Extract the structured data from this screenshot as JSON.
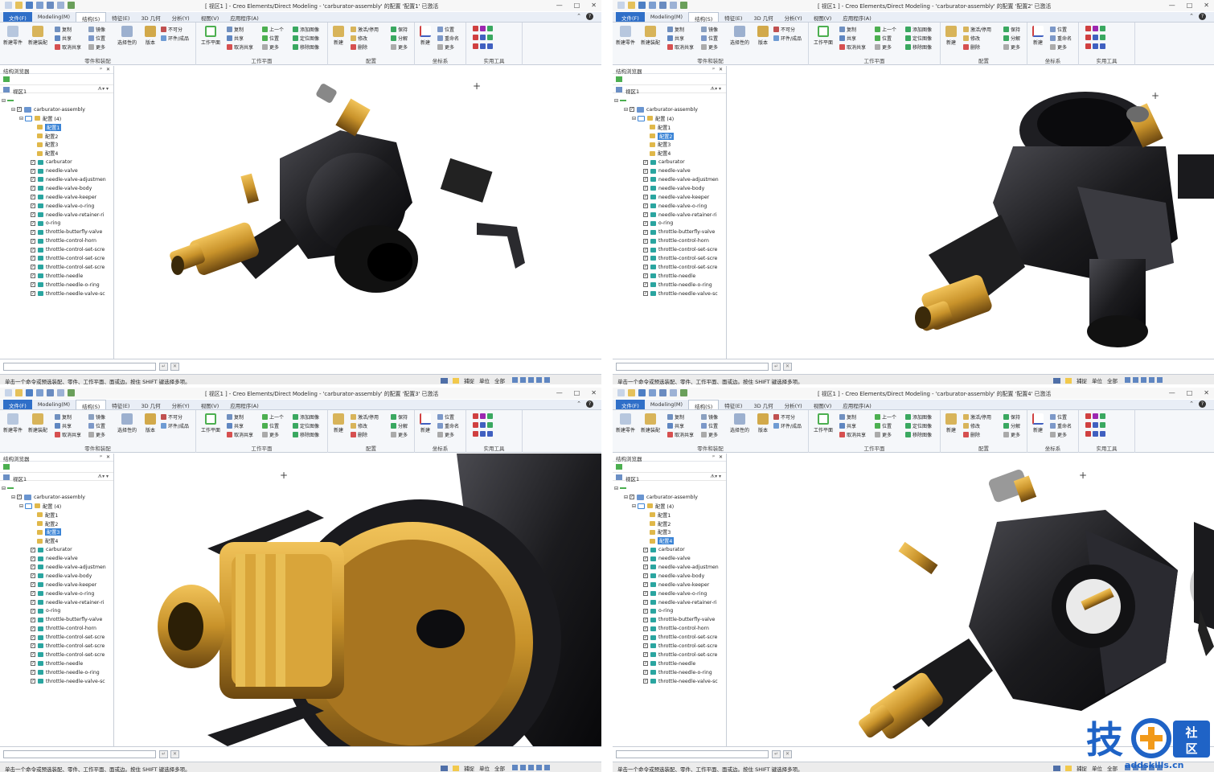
{
  "window": {
    "title_template_prefix": "[ 视区1 ] - Creo Elements/Direct Modeling - 'carburator-assembly' 的配置 ",
    "title_template_suffix": " 已激活",
    "buttons": [
      "—",
      "□",
      "✕"
    ]
  },
  "menu": {
    "tabs": [
      "文件(F)",
      "Modeling(M)",
      "结构(S)",
      "特征(E)",
      "3D 几何",
      "分析(Y)",
      "视图(V)",
      "应用程序(A)"
    ],
    "active_index": 2,
    "help": "?"
  },
  "ribbon": {
    "groups": {
      "parts_assemblies": "零件和装配",
      "workplane": "工作平面",
      "config": "配置",
      "coord": "坐标系",
      "tools": "实用工具"
    },
    "btn_new_part": "新建零件",
    "btn_new_assembly": "新建装配",
    "btn_copy": "复制",
    "btn_share": "共享",
    "btn_unshare": "取消共享",
    "btn_mirror": "镜像",
    "btn_position": "位置",
    "btn_more": "更多",
    "btn_selectable": "选择性的",
    "btn_version": "版本",
    "btn_unavailable": "不可分",
    "btn_std_parts": "环件/成品",
    "btn_workplane": "工作平面",
    "btn_wp_copy": "复制",
    "btn_wp_share": "共享",
    "btn_wp_unshare": "取消共享",
    "btn_prev": "上一个",
    "btn_wp_pos": "位置",
    "btn_wp_more": "更多",
    "btn_add_image": "添加图像",
    "btn_pos_image": "定位图像",
    "btn_remove_image": "移除图像",
    "btn_cfg_new": "新建",
    "btn_activate": "激活/停用",
    "btn_modify": "修改",
    "btn_delete": "删除",
    "btn_keep": "保持",
    "btn_split": "分解",
    "btn_cfg_more": "更多",
    "btn_cs_new": "新建",
    "btn_cs_pos": "位置",
    "btn_rename": "重命名",
    "btn_cs_more": "更多"
  },
  "browser": {
    "title": "结构浏览器",
    "pin": "ᵖ",
    "close": "✕",
    "view": "视区1",
    "assembly": "carburator-assembly",
    "config_folder": "配置 (4)",
    "configs": [
      "配置1",
      "配置2",
      "配置3",
      "配置4"
    ],
    "parts": [
      "carburator",
      "needle-valve",
      "needle-valve-adjustmen",
      "needle-valve-body",
      "needle-valve-keeper",
      "needle-valve-o-ring",
      "needle-valve-retainer-ri",
      "o-ring",
      "throttle-butterfly-valve",
      "throttle-control-horn",
      "throttle-control-set-scre",
      "throttle-control-set-scre",
      "throttle-control-set-scre",
      "throttle-needle",
      "throttle-needle-o-ring",
      "throttle-needle-valve-sc"
    ]
  },
  "statusbar": {
    "message": "单击一个命令或预选装配、零件、工作平面、面或边。按住 SHIFT 键选择多项。",
    "capture": "捕捉",
    "unit": "单位",
    "all": "全部"
  },
  "panes": [
    {
      "config_name": "'配置1'",
      "selected_config": 0,
      "view": "side-left"
    },
    {
      "config_name": "'配置2'",
      "selected_config": 1,
      "view": "top-iso"
    },
    {
      "config_name": "'配置3'",
      "selected_config": 2,
      "view": "closeup"
    },
    {
      "config_name": "'配置4'",
      "selected_config": 3,
      "view": "front-iso"
    }
  ],
  "watermark": {
    "brand": "技",
    "community": "社区",
    "url": "addskills.cn"
  },
  "colors": {
    "ribbon_bg": "#f5f7fa",
    "file_tab": "#2f6fc8",
    "selected": "#3b84d6",
    "body_black": "#1b1b1e",
    "brass": "#c8922a",
    "watermark_blue": "#1f63c6",
    "watermark_orange": "#f29a1a"
  }
}
